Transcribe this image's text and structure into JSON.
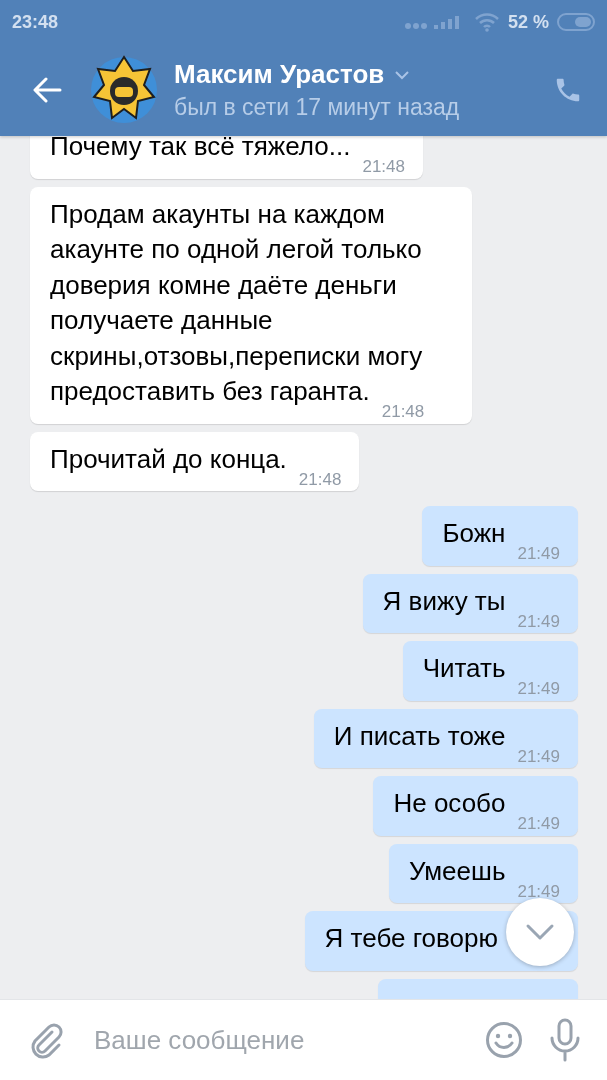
{
  "status_bar": {
    "time": "23:48",
    "battery": "52 %"
  },
  "header": {
    "name": "Максим Урастов",
    "status": "был в сети 17 минут назад"
  },
  "messages": [
    {
      "outgoing": false,
      "text": "Почему так всё тяжело...",
      "time": "21:48"
    },
    {
      "outgoing": false,
      "text": "Продам акаунты на каждом акаунте по одной легой только доверия комне даёте деньги получаете данные скрины,отзовы,переписки могу предоставить без гаранта.",
      "time": "21:48"
    },
    {
      "outgoing": false,
      "text": "Прочитай до конца.",
      "time": "21:48"
    },
    {
      "outgoing": true,
      "text": "Божн",
      "time": "21:49"
    },
    {
      "outgoing": true,
      "text": "Я вижу ты",
      "time": "21:49"
    },
    {
      "outgoing": true,
      "text": "Читать",
      "time": "21:49"
    },
    {
      "outgoing": true,
      "text": "И писать тоже",
      "time": "21:49"
    },
    {
      "outgoing": true,
      "text": "Не особо",
      "time": "21:49"
    },
    {
      "outgoing": true,
      "text": "Умеешь",
      "time": "21:49"
    },
    {
      "outgoing": true,
      "text": "Я тебе говорю"
    },
    {
      "outgoing": true
    }
  ],
  "composer": {
    "placeholder": "Ваше сообщение"
  }
}
